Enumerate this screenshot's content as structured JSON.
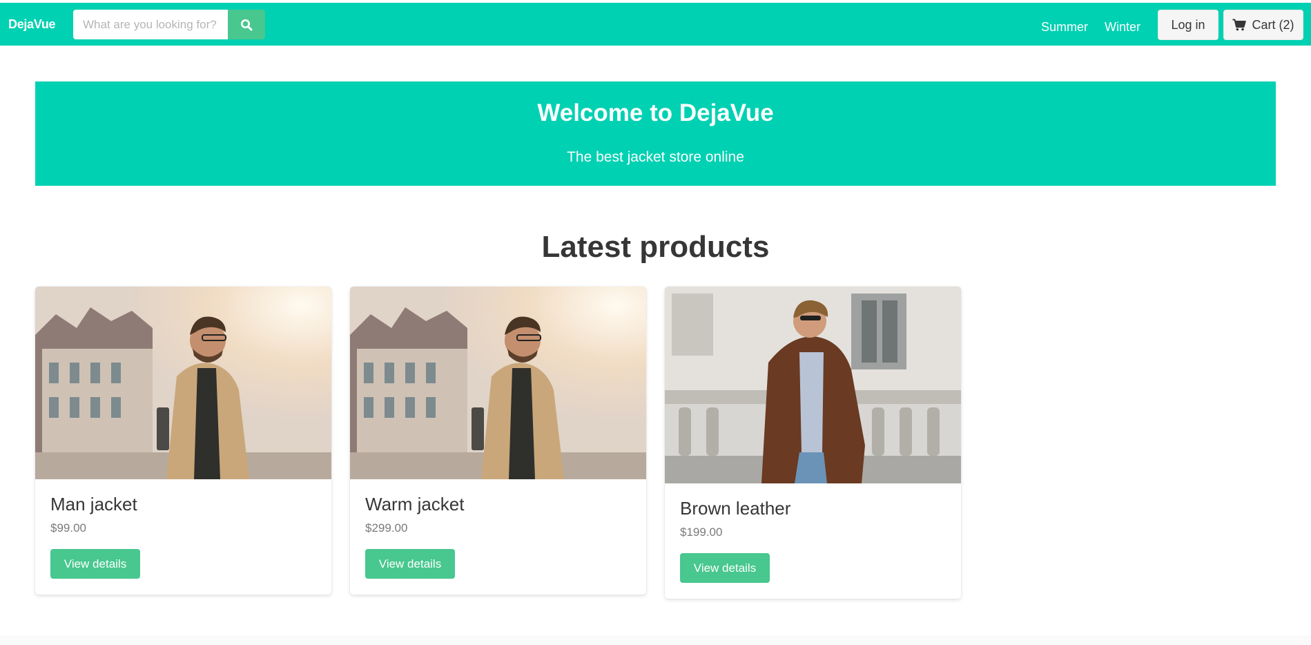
{
  "colors": {
    "primary": "#00d1b2",
    "success": "#48c78e",
    "text_dark": "#363636",
    "text_muted": "#7a7a7a"
  },
  "navbar": {
    "brand": "DejaVue",
    "search": {
      "placeholder": "What are you looking for?",
      "value": "",
      "button_icon": "search-icon"
    },
    "links": [
      {
        "label": "Summer"
      },
      {
        "label": "Winter"
      }
    ],
    "login_label": "Log in",
    "cart": {
      "icon": "cart-icon",
      "label": "Cart (2)"
    }
  },
  "hero": {
    "title": "Welcome to DejaVue",
    "subtitle": "The best jacket store online"
  },
  "products_section": {
    "title": "Latest products",
    "products": [
      {
        "name": "Man jacket",
        "price": "$99.00",
        "button_label": "View details"
      },
      {
        "name": "Warm jacket",
        "price": "$299.00",
        "button_label": "View details"
      },
      {
        "name": "Brown leather",
        "price": "$199.00",
        "button_label": "View details"
      }
    ]
  }
}
